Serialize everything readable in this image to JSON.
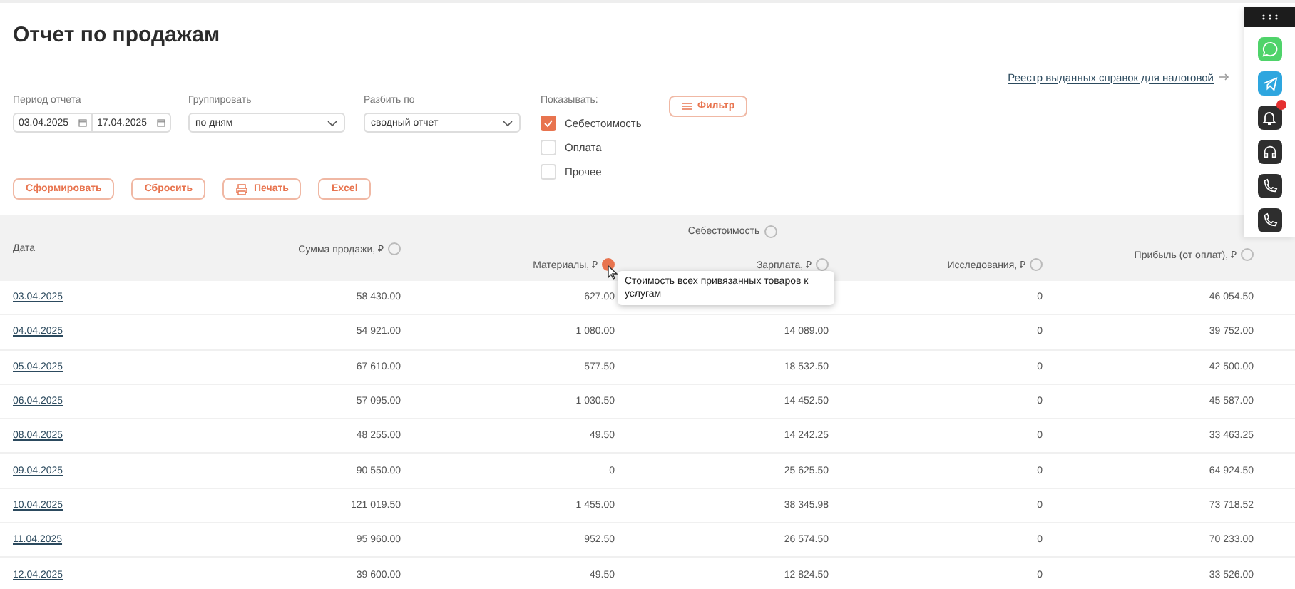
{
  "title": "Отчет по продажам",
  "registry_link": "Реестр выданных справок для налоговой",
  "filters": {
    "period": {
      "label": "Период отчета",
      "from": "03.04.2025",
      "to": "17.04.2025"
    },
    "group": {
      "label": "Группировать",
      "value": "по дням"
    },
    "split": {
      "label": "Разбить по",
      "value": "сводный отчет"
    },
    "show": {
      "label": "Показывать:",
      "options": [
        {
          "label": "Себестоимость",
          "checked": true
        },
        {
          "label": "Оплата",
          "checked": false
        },
        {
          "label": "Прочее",
          "checked": false
        }
      ]
    },
    "filter_button": "Фильтр"
  },
  "actions": [
    {
      "label": "Сформировать",
      "kind": "text"
    },
    {
      "label": "Сбросить",
      "kind": "text"
    },
    {
      "label": "Печать",
      "kind": "print"
    },
    {
      "label": "Excel",
      "kind": "text"
    }
  ],
  "table": {
    "group_header": "Себестоимость",
    "columns": [
      {
        "label": "Дата",
        "help": false
      },
      {
        "label": "Сумма продажи, ₽",
        "help": true
      },
      {
        "label": "Материалы, ₽",
        "help": true,
        "active": true
      },
      {
        "label": "Зарплата, ₽",
        "help": true
      },
      {
        "label": "Исследования, ₽",
        "help": true
      },
      {
        "label": "Прибыль (от оплат), ₽",
        "help": true
      }
    ],
    "rows": [
      [
        "03.04.2025",
        "58 430.00",
        "627.00",
        null,
        "0",
        "46 054.50"
      ],
      [
        "04.04.2025",
        "54 921.00",
        "1 080.00",
        "14 089.00",
        "0",
        "39 752.00"
      ],
      [
        "05.04.2025",
        "67 610.00",
        "577.50",
        "18 532.50",
        "0",
        "42 500.00"
      ],
      [
        "06.04.2025",
        "57 095.00",
        "1 030.50",
        "14 452.50",
        "0",
        "45 587.00"
      ],
      [
        "08.04.2025",
        "48 255.00",
        "49.50",
        "14 242.25",
        "0",
        "33 463.25"
      ],
      [
        "09.04.2025",
        "90 550.00",
        "0",
        "25 625.50",
        "0",
        "64 924.50"
      ],
      [
        "10.04.2025",
        "121 019.50",
        "1 455.00",
        "38 345.98",
        "0",
        "73 718.52"
      ],
      [
        "11.04.2025",
        "95 960.00",
        "952.50",
        "26 574.50",
        "0",
        "70 233.00"
      ],
      [
        "12.04.2025",
        "39 600.00",
        "49.50",
        "12 824.50",
        "0",
        "33 526.00"
      ]
    ],
    "tooltip": "Стоимость всех привязанных товаров к услугам"
  },
  "side_panel": [
    {
      "kind": "whatsapp"
    },
    {
      "kind": "telegram"
    },
    {
      "kind": "bell",
      "badge": true
    },
    {
      "kind": "headset"
    },
    {
      "kind": "phone"
    },
    {
      "kind": "phone"
    }
  ]
}
